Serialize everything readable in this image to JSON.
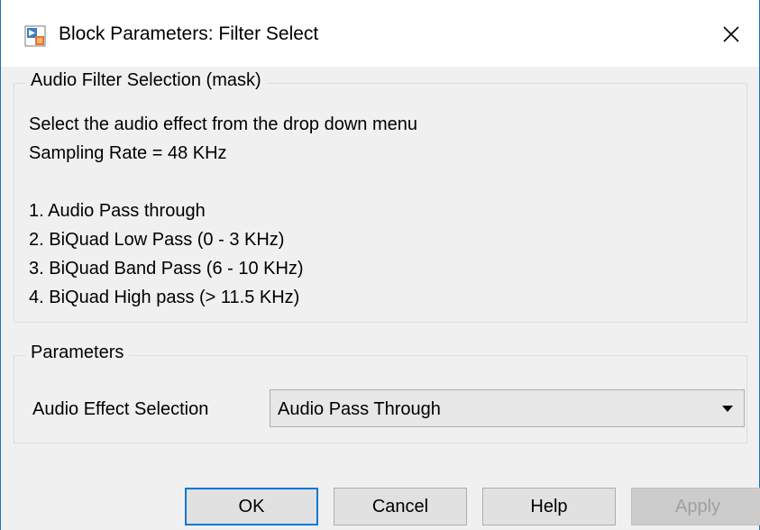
{
  "window": {
    "title": "Block Parameters: Filter Select",
    "close_glyph": "✕"
  },
  "mask_group": {
    "legend": "Audio Filter Selection (mask)",
    "lines": [
      "Select the audio effect from the drop down menu",
      "Sampling Rate = 48 KHz",
      "",
      "1. Audio Pass through",
      "2. BiQuad Low Pass (0 - 3 KHz)",
      "3. BiQuad Band Pass (6 - 10 KHz)",
      "4. BiQuad High pass (> 11.5 KHz)"
    ]
  },
  "parameters_group": {
    "legend": "Parameters",
    "field_label": "Audio Effect Selection",
    "selected_value": "Audio Pass Through"
  },
  "buttons": {
    "ok": "OK",
    "cancel": "Cancel",
    "help": "Help",
    "apply": "Apply"
  },
  "colors": {
    "accent": "#0078d7",
    "window_border": "#1a73b8",
    "dialog_bg": "#f0f0f0",
    "disabled_text": "#a0a0a0"
  },
  "icons": {
    "title_icon": "simulink-block-icon",
    "close_icon": "close-icon",
    "dropdown_icon": "chevron-down-icon"
  }
}
